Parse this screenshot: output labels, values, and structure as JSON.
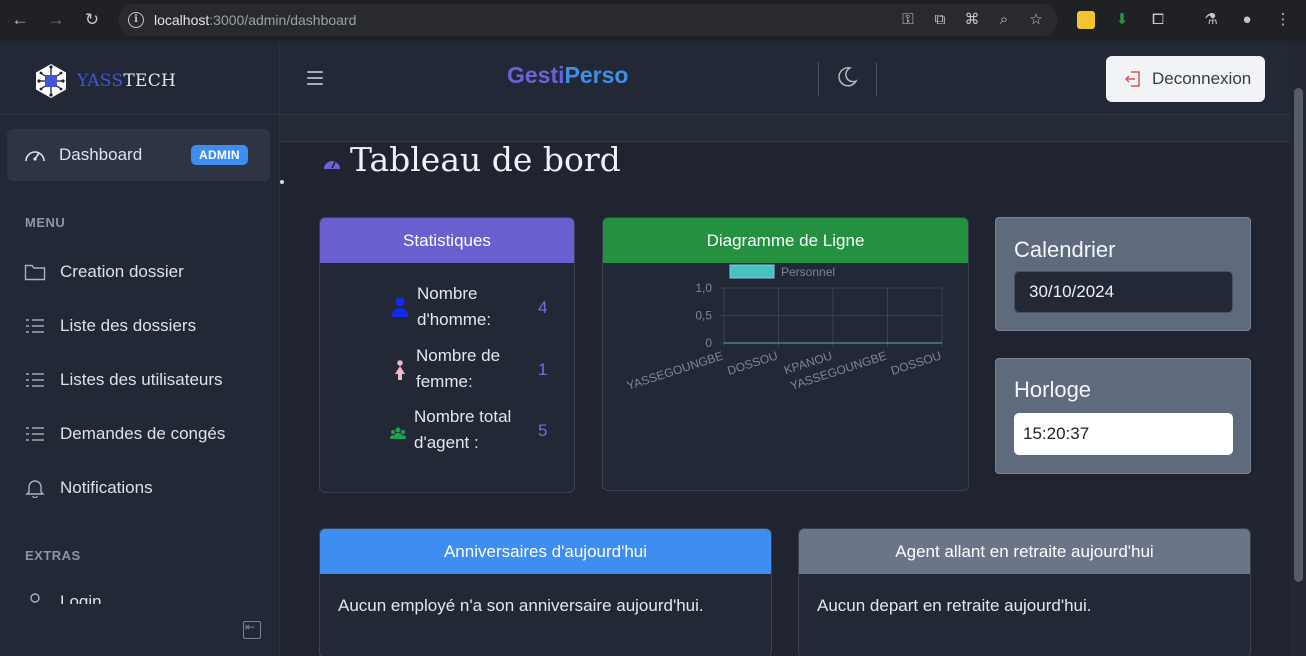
{
  "browser": {
    "url_host": "localhost",
    "url_path": ":3000/admin/dashboard"
  },
  "sidebar": {
    "brand_yass": "YASS",
    "brand_tech": "TECH",
    "active_item": {
      "label": "Dashboard",
      "badge": "ADMIN"
    },
    "menu_title": "MENU",
    "items": [
      {
        "label": "Creation dossier",
        "icon": "folder-icon"
      },
      {
        "label": "Liste des dossiers",
        "icon": "list-icon"
      },
      {
        "label": "Listes des utilisateurs",
        "icon": "list-icon"
      },
      {
        "label": "Demandes de congés",
        "icon": "list-icon"
      },
      {
        "label": "Notifications",
        "icon": "bell-icon"
      }
    ],
    "extras_title": "EXTRAS",
    "extras_partial_label": "Login"
  },
  "header": {
    "title_part1": "Gesti",
    "title_part2": "Perso",
    "logout_label": "Deconnexion"
  },
  "main": {
    "page_title": "Tableau de bord",
    "stats_card": {
      "title": "Statistiques",
      "rows": [
        {
          "label_line1": "Nombre",
          "label_line2": "d'homme:",
          "value": "4",
          "icon": "male-icon",
          "color": "#1428f0"
        },
        {
          "label_line1": "Nombre de",
          "label_line2": "femme:",
          "value": "1",
          "icon": "female-icon",
          "color": "#f2b8c6"
        },
        {
          "label_line1": "Nombre total",
          "label_line2": "d'agent :",
          "value": "5",
          "icon": "group-icon",
          "color": "#1fa34a"
        }
      ]
    },
    "chart_card": {
      "title": "Diagramme de Ligne"
    },
    "calendar": {
      "title": "Calendrier",
      "value": "30/10/2024"
    },
    "clock": {
      "title": "Horloge",
      "value": "15:20:37"
    },
    "birthday_card": {
      "title": "Anniversaires d'aujourd'hui",
      "text": "Aucun employé n'a son anniversaire aujourd'hui."
    },
    "retirement_card": {
      "title": "Agent allant en retraite aujourd'hui",
      "text": "Aucun depart en retraite aujourd'hui."
    }
  },
  "colors": {
    "stats_header": "#6960d0",
    "chart_header": "#23913f",
    "birthday_header": "#3d8ef0",
    "retirement_header": "#6b7587",
    "legend_fill": "#4bc0c0"
  },
  "chart_data": {
    "type": "bar",
    "categories": [
      "YASSEGOUNGBE",
      "DOSSOU",
      "KPANOU",
      "YASSEGOUNGBE",
      "DOSSOU"
    ],
    "series": [
      {
        "name": "Personnel",
        "values": [
          0,
          0,
          0,
          0,
          0
        ]
      }
    ],
    "ylim": [
      0,
      1.0
    ],
    "yticks": [
      "1,0",
      "0,5",
      "0"
    ],
    "legend": "top",
    "grid": true
  }
}
